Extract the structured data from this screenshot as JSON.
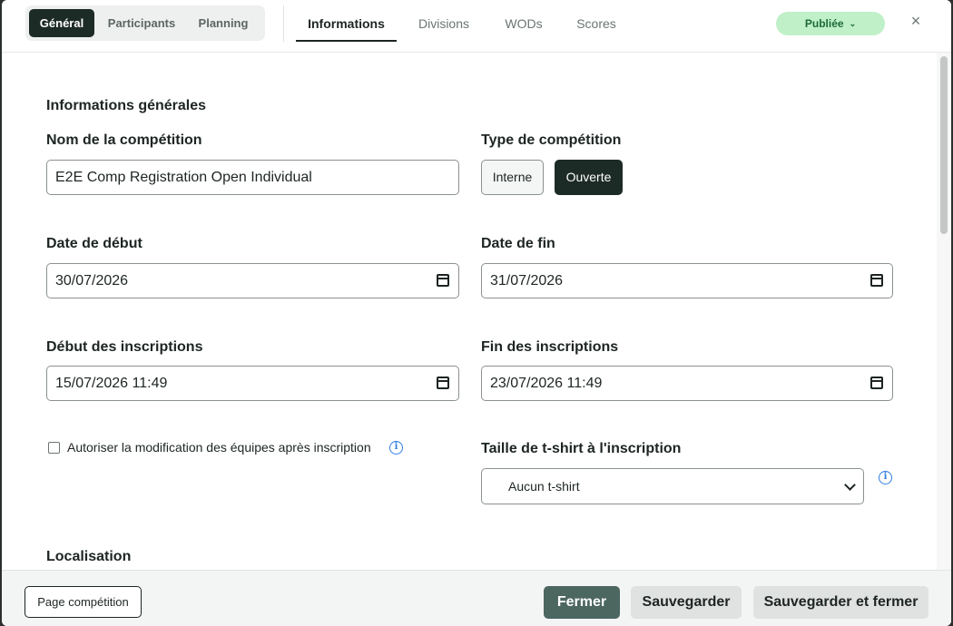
{
  "header": {
    "segments": [
      "Général",
      "Participants",
      "Planning"
    ],
    "active_segment": "Général",
    "tabs": [
      "Informations",
      "Divisions",
      "WODs",
      "Scores"
    ],
    "active_tab": "Informations",
    "status_label": "Publiée",
    "close_symbol": "×"
  },
  "form": {
    "section_general": "Informations générales",
    "name_label": "Nom de la compétition",
    "name_value": "E2E Comp Registration Open Individual",
    "type_label": "Type de compétition",
    "type_options": [
      "Interne",
      "Ouverte"
    ],
    "type_selected": "Ouverte",
    "start_date_label": "Date de début",
    "start_date_value": "30/07/2026",
    "end_date_label": "Date de fin",
    "end_date_value": "31/07/2026",
    "reg_start_label": "Début des inscriptions",
    "reg_start_value": "15/07/2026 11:49",
    "reg_end_label": "Fin des inscriptions",
    "reg_end_value": "23/07/2026 11:49",
    "allow_team_edit_label": "Autoriser la modification des équipes après inscription",
    "allow_team_edit_checked": false,
    "tshirt_label": "Taille de t-shirt à l'inscription",
    "tshirt_value": "Aucun t-shirt",
    "section_location": "Localisation"
  },
  "footer": {
    "page_button": "Page compétition",
    "close_button": "Fermer",
    "save_button": "Sauvegarder",
    "save_close_button": "Sauvegarder et fermer"
  },
  "colors": {
    "accent_dark": "#1d2b27",
    "status_bg": "#bff0c8",
    "status_text": "#1d6a38",
    "info_blue": "#2f7de1",
    "close_button_bg": "#4c6660"
  },
  "icons": [
    "chevron-down-icon",
    "close-icon",
    "calendar-icon",
    "info-icon"
  ]
}
